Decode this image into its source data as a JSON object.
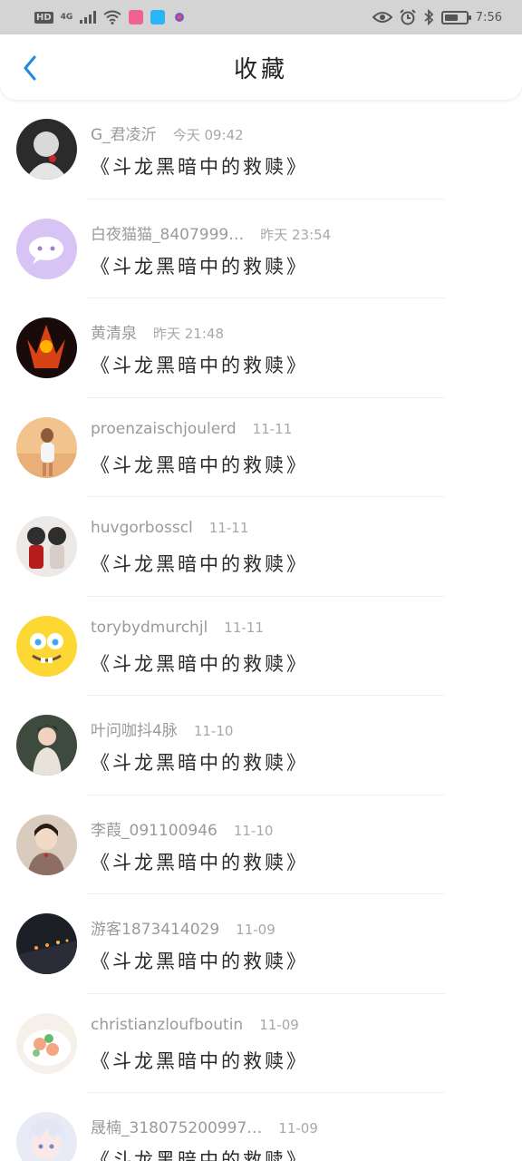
{
  "status_bar": {
    "hd": "HD",
    "signal": "4G",
    "time": "7:56",
    "battery_level": 0.65
  },
  "header": {
    "title": "收藏",
    "back_icon": "chevron-left-icon",
    "accent": "#1e88e5"
  },
  "favorites": [
    {
      "name": "G_君凌沂",
      "time": "今天 09:42",
      "title": "《斗龙黑暗中的救赎》"
    },
    {
      "name": "白夜猫猫_8407999…",
      "time": "昨天 23:54",
      "title": "《斗龙黑暗中的救赎》"
    },
    {
      "name": "黄清泉",
      "time": "昨天 21:48",
      "title": "《斗龙黑暗中的救赎》"
    },
    {
      "name": "proenzaischjoulerd",
      "time": "11-11",
      "title": "《斗龙黑暗中的救赎》"
    },
    {
      "name": "huvgorbosscl",
      "time": "11-11",
      "title": "《斗龙黑暗中的救赎》"
    },
    {
      "name": "torybydmurchjl",
      "time": "11-11",
      "title": "《斗龙黑暗中的救赎》"
    },
    {
      "name": "叶问咖抖4脉",
      "time": "11-10",
      "title": "《斗龙黑暗中的救赎》"
    },
    {
      "name": "李葭_091100946",
      "time": "11-10",
      "title": "《斗龙黑暗中的救赎》"
    },
    {
      "name": "游客1873414029",
      "time": "11-09",
      "title": "《斗龙黑暗中的救赎》"
    },
    {
      "name": "christianzloufboutin",
      "time": "11-09",
      "title": "《斗龙黑暗中的救赎》"
    },
    {
      "name": "晟楠_318075200997…",
      "time": "11-09",
      "title": "《斗龙黑暗中的救赎》"
    }
  ]
}
